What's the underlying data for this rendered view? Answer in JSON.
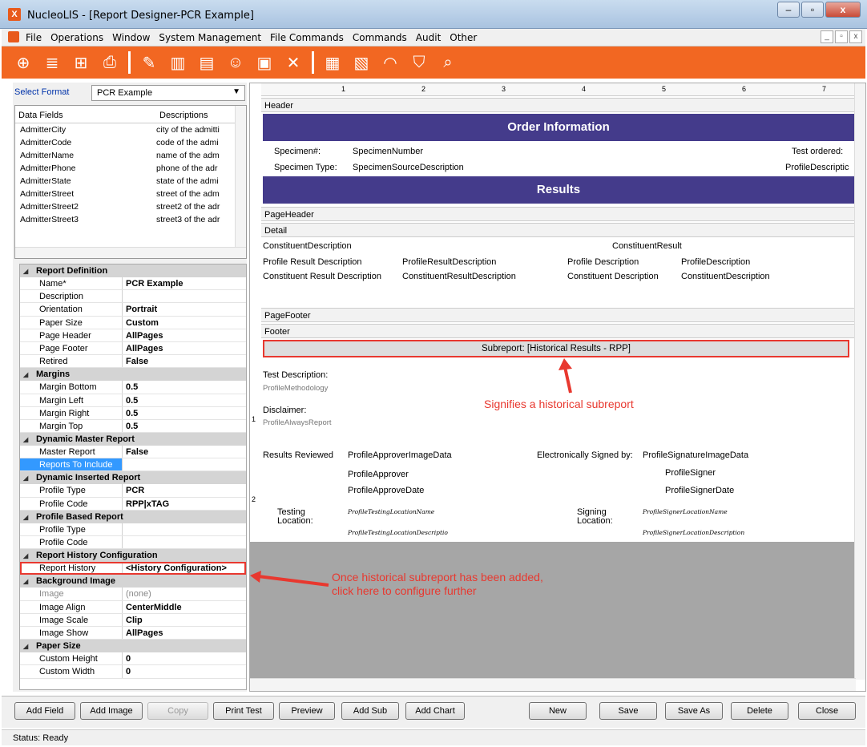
{
  "window": {
    "title": "NucleoLIS - [Report Designer-PCR Example]",
    "app_icon": "X",
    "controls": [
      "–",
      "▫",
      "x"
    ]
  },
  "menu": [
    "File",
    "Operations",
    "Window",
    "System Management",
    "File Commands",
    "Commands",
    "Audit",
    "Other"
  ],
  "mdi_controls": [
    "_",
    "▫",
    "x"
  ],
  "left": {
    "select_format_label": "Select Format",
    "select_format_value": "PCR Example",
    "fields_headers": [
      "Data Fields",
      "Descriptions"
    ],
    "fields": [
      [
        "AdmitterCity",
        "city of the admitti"
      ],
      [
        "AdmitterCode",
        "code of the admi"
      ],
      [
        "AdmitterName",
        "name of the adm"
      ],
      [
        "AdmitterPhone",
        "phone of the adr"
      ],
      [
        "AdmitterState",
        "state of the admi"
      ],
      [
        "AdmitterStreet",
        "street of the adm"
      ],
      [
        "AdmitterStreet2",
        "street2 of the adr"
      ],
      [
        "AdmitterStreet3",
        "street3 of the adr"
      ]
    ],
    "props": {
      "report_definition": "Report Definition",
      "name_k": "Name*",
      "name_v": "PCR Example",
      "desc_k": "Description",
      "desc_v": "",
      "orient_k": "Orientation",
      "orient_v": "Portrait",
      "paper_k": "Paper Size",
      "paper_v": "Custom",
      "phdr_k": "Page Header",
      "phdr_v": "AllPages",
      "pftr_k": "Page Footer",
      "pftr_v": "AllPages",
      "retired_k": "Retired",
      "retired_v": "False",
      "margins": "Margins",
      "mb_k": "Margin Bottom",
      "mb_v": "0.5",
      "ml_k": "Margin Left",
      "ml_v": "0.5",
      "mr_k": "Margin Right",
      "mr_v": "0.5",
      "mt_k": "Margin Top",
      "mt_v": "0.5",
      "dmr": "Dynamic Master Report",
      "master_k": "Master Report",
      "master_v": "False",
      "rti_k": "Reports To Include",
      "rti_v": "",
      "dir": "Dynamic Inserted Report",
      "ptype_k": "Profile Type",
      "ptype_v": "PCR",
      "pcode_k": "Profile Code",
      "pcode_v": "RPP|xTAG",
      "pbr": "Profile Based Report",
      "ptype2_k": "Profile Type",
      "ptype2_v": "",
      "pcode2_k": "Profile Code",
      "pcode2_v": "",
      "rhc": "Report History Configuration",
      "rh_k": "Report History",
      "rh_v": "<History Configuration>",
      "bgi": "Background Image",
      "img_k": "Image",
      "img_v": "(none)",
      "ialign_k": "Image Align",
      "ialign_v": "CenterMiddle",
      "iscale_k": "Image Scale",
      "iscale_v": "Clip",
      "ishow_k": "Image Show",
      "ishow_v": "AllPages",
      "psize": "Paper Size",
      "ch_k": "Custom Height",
      "ch_v": "0",
      "cw_k": "Custom Width",
      "cw_v": "0"
    }
  },
  "designer": {
    "ruler": [
      "1",
      "2",
      "3",
      "4",
      "5",
      "6",
      "7"
    ],
    "vruler": [
      "1",
      "2"
    ],
    "bands": {
      "header": "Header",
      "pageheader": "PageHeader",
      "detail": "Detail",
      "pagefooter": "PageFooter",
      "footer": "Footer"
    },
    "order_info": "Order Information",
    "results": "Results",
    "specimen_label": "Specimen#:",
    "specimen_value": "SpecimenNumber",
    "test_ordered": "Test ordered:",
    "spec_type_label": "Specimen Type:",
    "spec_type_value": "SpecimenSourceDescription",
    "profile_desc": "ProfileDescriptic",
    "constituent_desc": "ConstituentDescription",
    "constituent_result": "ConstituentResult",
    "prd_label": "Profile Result Description",
    "prd_value": "ProfileResultDescription",
    "pd_label": "Profile Description",
    "pd_value": "ProfileDescription",
    "crd_label": "Constituent Result Description",
    "crd_value": "ConstituentResultDescription",
    "cd_label": "Constituent Description",
    "cd_value": "ConstituentDescription",
    "subreport": "Subreport: [Historical Results - RPP]",
    "test_desc": "Test Description:",
    "profile_method": "ProfileMethodology",
    "disclaimer": "Disclaimer:",
    "always_report": "ProfileAlwaysReport",
    "results_reviewed": "Results Reviewed",
    "approver_img": "ProfileApproverImageData",
    "approver": "ProfileApprover",
    "approve_date": "ProfileApproveDate",
    "e_signed": "Electronically Signed by:",
    "signature_img": "ProfileSignatureImageData",
    "signer": "ProfileSigner",
    "signer_date": "ProfileSignerDate",
    "testing_loc": "Testing Location:",
    "testing_loc_name": "ProfileTestingLocationName",
    "testing_loc_desc": "ProfileTestingLocationDescriptio",
    "signing_loc": "Signing Location:",
    "signer_loc_name": "ProfileSignerLocationName",
    "signer_loc_desc": "ProfileSignerLocationDescription"
  },
  "annotations": {
    "historical": "Signifies a historical subreport",
    "configure": "Once historical subreport has been added, click here to configure further"
  },
  "buttons": {
    "add_field": "Add Field",
    "add_image": "Add Image",
    "copy": "Copy",
    "print_test": "Print Test",
    "preview": "Preview",
    "add_sub": "Add Sub",
    "add_chart": "Add Chart",
    "new": "New",
    "save": "Save",
    "save_as": "Save As",
    "delete": "Delete",
    "close": "Close"
  },
  "status": "Status: Ready",
  "colors": {
    "toolbar": "#f26722",
    "band_purple": "#443b8b",
    "annotation": "#e8382f"
  }
}
